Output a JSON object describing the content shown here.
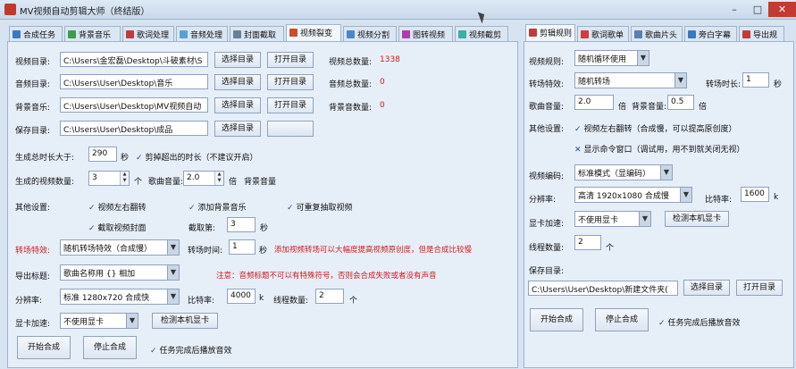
{
  "app": {
    "title": "MV视频自动剪辑大师（终结版）",
    "minimize_glyph": "–",
    "maximize_glyph": "□",
    "close_glyph": "✕"
  },
  "left_tabs": [
    "合成任务",
    "背景音乐",
    "歌词处理",
    "音频处理",
    "封面截取",
    "视频裂变",
    "视频分割",
    "图转视频",
    "视频截剪"
  ],
  "left_tab_icon_colors": [
    "#3a78c2",
    "#3e9c4a",
    "#c23a3a",
    "#5aa0d8",
    "#6a7f96",
    "#d04a2a",
    "#4a88c8",
    "#b03ab0",
    "#3ab0a0"
  ],
  "right_tabs": [
    "剪辑规则",
    "歌词歌单",
    "歌曲片头",
    "旁白字幕",
    "导出规"
  ],
  "right_tab_icon_colors": [
    "#c23a3a",
    "#d13a3a",
    "#5a7fb0",
    "#3a78c2",
    "#c23a3a"
  ],
  "left": {
    "video_dir": {
      "label": "视频目录:",
      "value": "C:\\Users\\金宏磊\\Desktop\\斗破素材\\S",
      "select": "选择目录",
      "open": "打开目录",
      "count_label": "视频总数量:",
      "count": "1338"
    },
    "audio_dir": {
      "label": "音频目录:",
      "value": "C:\\Users\\User\\Desktop\\音乐",
      "select": "选择目录",
      "open": "打开目录",
      "count_label": "音频总数量:",
      "count": "0"
    },
    "bgm_dir": {
      "label": "背景音乐:",
      "value": "C:\\Users\\User\\Desktop\\MV视频自动",
      "select": "选择目录",
      "open": "打开目录",
      "count_label": "背景音数量:",
      "count": "0"
    },
    "save_dir": {
      "label": "保存目录:",
      "value": "C:\\Users\\User\\Desktop\\成品",
      "select": "选择目录"
    },
    "min_duration": {
      "label": "生成总时长大于:",
      "value": "290",
      "unit": "秒",
      "trim_label": "剪掉超出的时长（不建议开启）"
    },
    "video_count": {
      "label": "生成的视频数量:",
      "value": "3",
      "unit": "个",
      "song_vol_label": "歌曲音量:",
      "song_vol": "2.0",
      "song_vol_unit": "倍",
      "bgm_vol_label": "背景音量"
    },
    "other": {
      "label": "其他设置:",
      "flip": "视频左右翻转",
      "add_bgm": "添加背景音乐",
      "repeat": "可重复抽取视频",
      "cover": "截取视频封面",
      "cover_frame_label": "截取第:",
      "cover_frame": "3",
      "cover_frame_unit": "秒"
    },
    "transition": {
      "label": "转场特效:",
      "value": "随机转场特效（合成慢）",
      "time_label": "转场时间:",
      "time": "1",
      "time_unit": "秒",
      "note": "添加视频转场可以大幅度提高视频原创度，但是合成比较慢"
    },
    "export_title": {
      "label": "导出标题:",
      "value": "歌曲名称用 {} 相加",
      "note": "注意：音频标题不可以有特殊符号，否则会合成失败或者没有声音"
    },
    "resolution": {
      "label": "分辨率:",
      "value": "标准 1280x720 合成快",
      "bitrate_label": "比特率:",
      "bitrate": "4000",
      "bitrate_unit": "k",
      "threads_label": "线程数量:",
      "threads": "2",
      "threads_unit": "个"
    },
    "gpu": {
      "label": "显卡加速:",
      "value": "不使用显卡",
      "detect": "检测本机显卡"
    },
    "start": "开始合成",
    "stop": "停止合成",
    "sound_label": "任务完成后播放音效"
  },
  "right": {
    "rule": {
      "label": "视频规则:",
      "value": "随机循环使用"
    },
    "transition": {
      "label": "转场特效:",
      "value": "随机转场",
      "time_label": "转场时长:",
      "time": "1",
      "unit": "秒"
    },
    "song_vol": {
      "label": "歌曲音量:",
      "value": "2.0",
      "unit": "倍",
      "bgm_label": "背景音量:",
      "bgm": "0.5",
      "bgm_unit": "倍"
    },
    "other": {
      "label": "其他设置:",
      "flip": "视频左右翻转（合成慢，可以提高原创度）",
      "console": "显示命令窗口（调试用，用不到就关闭无视）"
    },
    "encode": {
      "label": "视频编码:",
      "value": "标准模式（显编码）"
    },
    "resolution": {
      "label": "分辨率:",
      "value": "高清 1920x1080 合成慢",
      "bitrate_label": "比特率:",
      "bitrate": "1600",
      "bitrate_unit": "k"
    },
    "gpu": {
      "label": "显卡加速:",
      "value": "不使用显卡",
      "detect": "检测本机显卡"
    },
    "threads": {
      "label": "线程数量:",
      "value": "2",
      "unit": "个"
    },
    "save": {
      "label": "保存目录:",
      "value": "C:\\Users\\User\\Desktop\\新建文件夹(",
      "select": "选择目录",
      "open": "打开目录"
    },
    "start": "开始合成",
    "stop": "停止合成",
    "sound_label": "任务完成后播放音效"
  }
}
